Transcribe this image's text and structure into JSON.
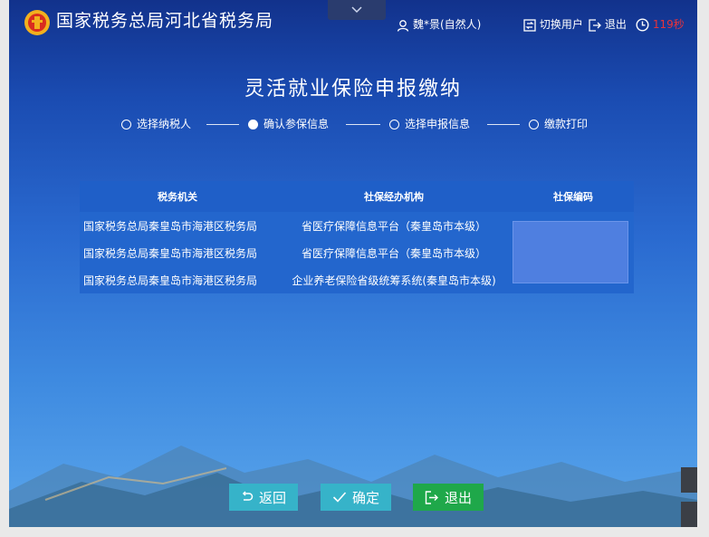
{
  "header": {
    "org_title": "国家税务总局河北省税务局",
    "user_label": "魏*景(自然人)",
    "switch_user_label": "切换用户",
    "logout_label": "退出",
    "timer_value": "119秒"
  },
  "page": {
    "title": "灵活就业保险申报缴纳"
  },
  "steps": [
    {
      "label": "选择纳税人",
      "done": false
    },
    {
      "label": "确认参保信息",
      "done": true
    },
    {
      "label": "选择申报信息",
      "done": false
    },
    {
      "label": "缴款打印",
      "done": false
    }
  ],
  "table": {
    "headers": [
      "税务机关",
      "社保经办机构",
      "社保编码"
    ],
    "rows": [
      [
        "国家税务总局秦皇岛市海港区税务局",
        "省医疗保障信息平台（秦皇岛市本级）",
        ""
      ],
      [
        "国家税务总局秦皇岛市海港区税务局",
        "省医疗保障信息平台（秦皇岛市本级）",
        ""
      ],
      [
        "国家税务总局秦皇岛市海港区税务局",
        "企业养老保险省级统筹系统(秦皇岛市本级)",
        ""
      ]
    ]
  },
  "buttons": {
    "back": "返回",
    "confirm": "确定",
    "exit": "退出"
  },
  "icons": [
    "emblem-icon",
    "chevron-down-icon",
    "user-icon",
    "switch-icon",
    "logout-icon",
    "clock-icon",
    "undo-icon",
    "check-icon",
    "exit-icon"
  ],
  "colors": {
    "timer": "#e8333a",
    "exit_button": "#1fa84a",
    "action_button": "#36b3c9"
  }
}
